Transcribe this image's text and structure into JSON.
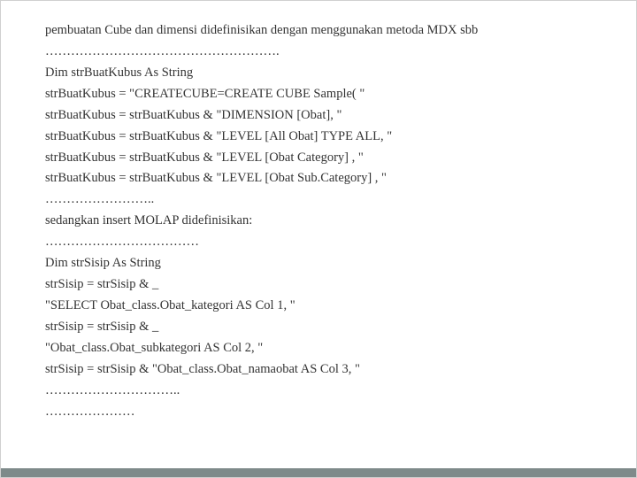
{
  "lines": [
    "pembuatan Cube dan dimensi didefinisikan dengan menggunakan metoda MDX sbb",
    "……………………………………………….",
    "Dim strBuatKubus As String",
    "strBuatKubus = \"CREATECUBE=CREATE CUBE Sample( \"",
    "strBuatKubus = strBuatKubus & \"DIMENSION [Obat], \"",
    "strBuatKubus = strBuatKubus & \"LEVEL [All Obat] TYPE ALL, \"",
    "strBuatKubus = strBuatKubus & \"LEVEL [Obat Category] , \"",
    "strBuatKubus = strBuatKubus & \"LEVEL [Obat Sub.Category] , \"",
    "……………………..",
    "sedangkan insert MOLAP didefinisikan:",
    "………………………………",
    "Dim strSisip As String",
    "strSisip = strSisip & _",
    "\"SELECT Obat_class.Obat_kategori AS Col 1, \"",
    "strSisip = strSisip & _",
    "\"Obat_class.Obat_subkategori AS Col 2, \"",
    "strSisip = strSisip & \"Obat_class.Obat_namaobat AS Col 3, \"",
    "…………………………..",
    "…………………"
  ]
}
